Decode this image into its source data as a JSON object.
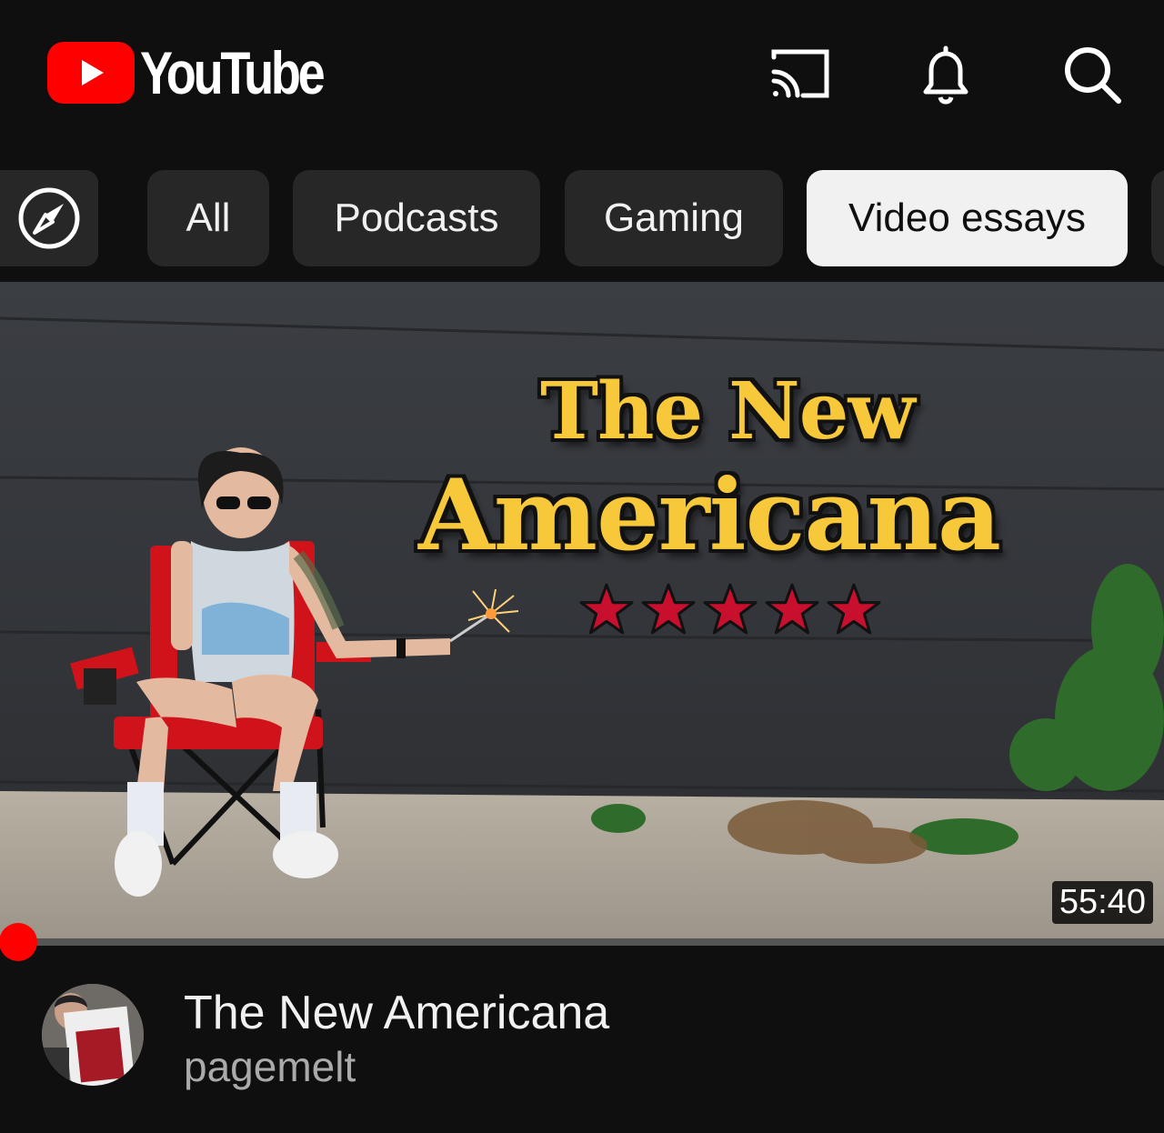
{
  "header": {
    "logo_text": "YouTube",
    "icons": [
      "cast-icon",
      "bell-icon",
      "search-icon"
    ]
  },
  "chips": {
    "explore_icon": "compass-icon",
    "items": [
      {
        "label": "All",
        "active": false
      },
      {
        "label": "Podcasts",
        "active": false
      },
      {
        "label": "Gaming",
        "active": false
      },
      {
        "label": "Video essays",
        "active": true
      }
    ]
  },
  "video": {
    "thumbnail_text_line1": "The New",
    "thumbnail_text_line2": "Americana",
    "thumbnail_star_count": 5,
    "duration": "55:40",
    "watch_progress": 0.01,
    "title": "The New Americana",
    "channel": "pagemelt"
  },
  "colors": {
    "background": "#0f0f0f",
    "chip_bg": "#272727",
    "chip_active_bg": "#f1f1f1",
    "brand_red": "#ff0000",
    "thumbnail_title": "#f6c83a",
    "star_red": "#c8102e"
  }
}
